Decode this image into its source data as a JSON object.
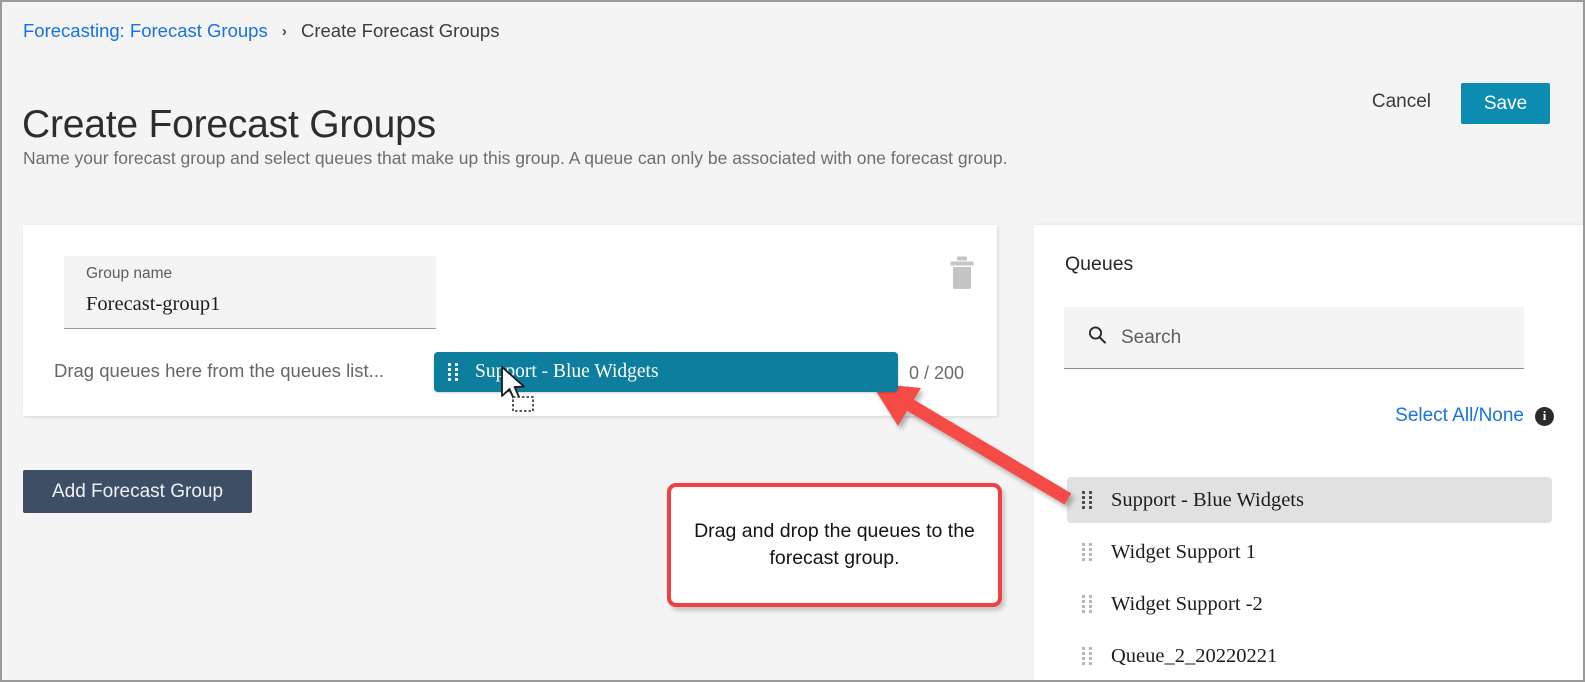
{
  "breadcrumb": {
    "parent": "Forecasting: Forecast Groups",
    "separator": "›",
    "current": "Create Forecast Groups"
  },
  "header": {
    "title": "Create Forecast Groups",
    "cancel_label": "Cancel",
    "save_label": "Save",
    "description": "Name your forecast group and select queues that make up this group. A queue can only be associated with one forecast group."
  },
  "group_card": {
    "group_name_label": "Group name",
    "group_name_value": "Forecast-group1",
    "delete_icon": "trash-icon",
    "drop_hint": "Drag queues here from the queues list...",
    "counter": "0 / 200",
    "dragged_chip": {
      "handle_icon": "drag-handle-icon",
      "label": "Support - Blue Widgets"
    }
  },
  "add_group_button": {
    "label": "Add Forecast Group"
  },
  "queues_panel": {
    "title": "Queues",
    "search": {
      "icon": "search-icon",
      "placeholder": "Search",
      "value": ""
    },
    "select_all_label": "Select All/None",
    "info_icon": "info-icon",
    "info_glyph": "i",
    "items": [
      {
        "label": "Support - Blue Widgets",
        "selected": true
      },
      {
        "label": "Widget Support 1",
        "selected": false
      },
      {
        "label": "Widget Support -2",
        "selected": false
      },
      {
        "label": "Queue_2_20220221",
        "selected": false
      }
    ]
  },
  "annotation": {
    "callout_text": "Drag and drop the queues to the forecast group.",
    "arrow": "red-arrow-icon",
    "color": "#f04040"
  },
  "colors": {
    "page_background": "#f4f4f4",
    "card_background": "#ffffff",
    "link": "#1673e0",
    "save_teal": "#0b8cb0",
    "chip_teal": "#0d7e9e",
    "add_button_slate": "#3e4e64",
    "annotation_red": "#f04040",
    "selected_row": "#e1e1e1"
  },
  "cursor": {
    "icon": "drag-cursor-icon"
  }
}
